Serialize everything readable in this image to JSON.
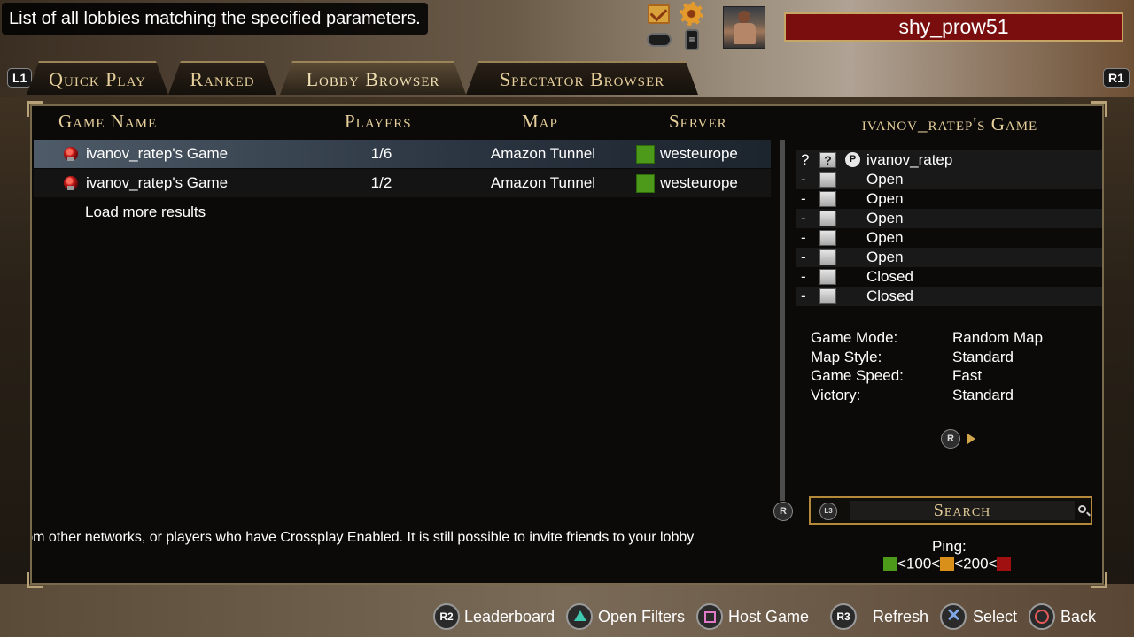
{
  "hint": "List of all lobbies matching the specified parameters.",
  "user": {
    "name": "shy_prow51"
  },
  "top_icons": [
    "mail-icon",
    "gear-icon",
    "controller-icon",
    "menu-icon"
  ],
  "tabs": {
    "left_bumper": "L1",
    "right_bumper": "R1",
    "items": [
      {
        "label": "Quick Play",
        "active": false
      },
      {
        "label": "Ranked",
        "active": false
      },
      {
        "label": "Lobby Browser",
        "active": true
      },
      {
        "label": "Spectator Browser",
        "active": false
      }
    ]
  },
  "table": {
    "headers": {
      "name": "Game Name",
      "players": "Players",
      "map": "Map",
      "server": "Server"
    },
    "rows": [
      {
        "name": "ivanov_ratep's Game",
        "players": "1/6",
        "map": "Amazon Tunnel",
        "server": "westeurope",
        "ping": "good",
        "selected": true
      },
      {
        "name": "ivanov_ratep's Game",
        "players": "1/2",
        "map": "Amazon Tunnel",
        "server": "westeurope",
        "ping": "good",
        "selected": false
      }
    ],
    "load_more": "Load more results"
  },
  "scroll_button": "R",
  "ticker": "s from other networks, or players who have Crossplay Enabled. It is still possible to invite friends to your lobby",
  "detail": {
    "title": "ivanov_ratep's Game",
    "slots": [
      {
        "mark": "?",
        "box": "?",
        "label": "ivanov_ratep"
      },
      {
        "mark": "-",
        "box": "",
        "label": "Open"
      },
      {
        "mark": "-",
        "box": "",
        "label": "Open"
      },
      {
        "mark": "-",
        "box": "",
        "label": "Open"
      },
      {
        "mark": "-",
        "box": "",
        "label": "Open"
      },
      {
        "mark": "-",
        "box": "",
        "label": "Open"
      },
      {
        "mark": "-",
        "box": "",
        "label": "Closed"
      },
      {
        "mark": "-",
        "box": "",
        "label": "Closed"
      }
    ],
    "settings": [
      {
        "key": "Game Mode:",
        "value": "Random Map"
      },
      {
        "key": "Map Style:",
        "value": "Standard"
      },
      {
        "key": "Game Speed:",
        "value": "Fast"
      },
      {
        "key": "Victory:",
        "value": "Standard"
      }
    ],
    "details_button": "R"
  },
  "search": {
    "button": "L3",
    "label": "Search"
  },
  "ping": {
    "label": "Ping:",
    "t1": "<100<",
    "t2": "<200<",
    "colors": {
      "good": "#4d9a1a",
      "medium": "#d9901a",
      "bad": "#a01010"
    }
  },
  "controls": [
    {
      "button": "R2",
      "label": "Leaderboard"
    },
    {
      "button": "triangle",
      "label": "Open Filters"
    },
    {
      "button": "square",
      "label": "Host Game"
    },
    {
      "button": "R3",
      "label": "Refresh"
    },
    {
      "button": "cross",
      "label": "Select"
    },
    {
      "button": "circle",
      "label": "Back"
    }
  ]
}
